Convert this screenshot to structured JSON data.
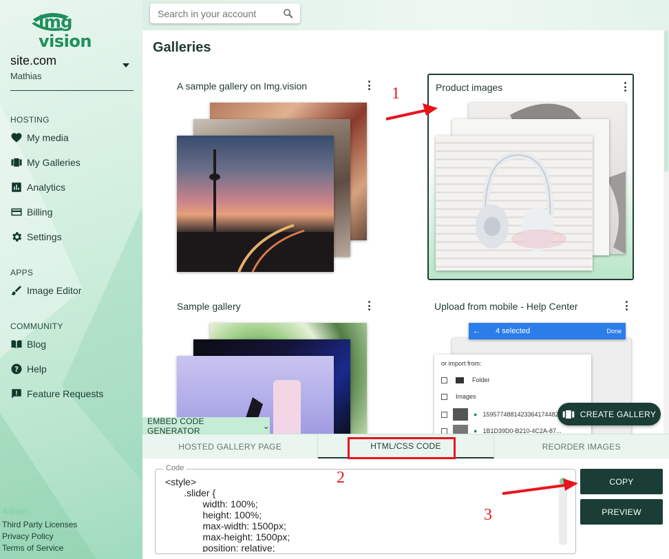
{
  "app": {
    "logo_text": "img vision",
    "brand_color": "#1f8f5c",
    "dark_color": "#1a3d36"
  },
  "account": {
    "site": "site.com",
    "user": "Mathias"
  },
  "sidebar": {
    "hosting_label": "HOSTING",
    "hosting_items": [
      {
        "label": "My media",
        "icon": "heart-icon"
      },
      {
        "label": "My Galleries",
        "icon": "galleries-icon"
      },
      {
        "label": "Analytics",
        "icon": "analytics-icon"
      },
      {
        "label": "Billing",
        "icon": "credit-card-icon"
      },
      {
        "label": "Settings",
        "icon": "gear-icon"
      }
    ],
    "apps_label": "APPS",
    "apps_items": [
      {
        "label": "Image Editor",
        "icon": "brush-icon"
      }
    ],
    "community_label": "COMMUNITY",
    "community_items": [
      {
        "label": "Blog",
        "icon": "book-icon"
      },
      {
        "label": "Help",
        "icon": "help-icon"
      },
      {
        "label": "Feature Requests",
        "icon": "feedback-icon"
      }
    ],
    "footer": {
      "admin": "Admin",
      "links": [
        "Third Party Licenses",
        "Privacy Policy",
        "Terms of Service"
      ]
    }
  },
  "search": {
    "placeholder": "Search in your account"
  },
  "main": {
    "title": "Galleries",
    "galleries": [
      {
        "title": "A sample gallery on Img.vision",
        "selected": false
      },
      {
        "title": "Product images",
        "selected": true
      },
      {
        "title": "Sample gallery",
        "selected": false
      },
      {
        "title": "Upload from mobile - Help Center",
        "selected": false
      }
    ],
    "mobile_screenshot": {
      "header": "4 selected",
      "done": "Done",
      "import_text": "or import from:",
      "folder": "Folder",
      "images": "Images",
      "file1": "1595774881423364174482...",
      "file2": "1B1D39D0-B210-4C2A-87..."
    },
    "create_gallery_label": "CREATE GALLERY"
  },
  "embed": {
    "tag_label": "EMBED CODE GENERATOR",
    "tabs": [
      "HOSTED GALLERY PAGE",
      "HTML/CSS CODE",
      "REORDER IMAGES"
    ],
    "active_tab": 1,
    "code_legend": "Code",
    "code_text": "<style>\n       .slider {\n              width: 100%;\n              height: 100%;\n              max-width: 1500px;\n              max-height: 1500px;\n              position: relative;",
    "copy_label": "COPY",
    "preview_label": "PREVIEW"
  },
  "annotations": {
    "one": "1",
    "two": "2",
    "three": "3",
    "color": "#e21c1c"
  }
}
